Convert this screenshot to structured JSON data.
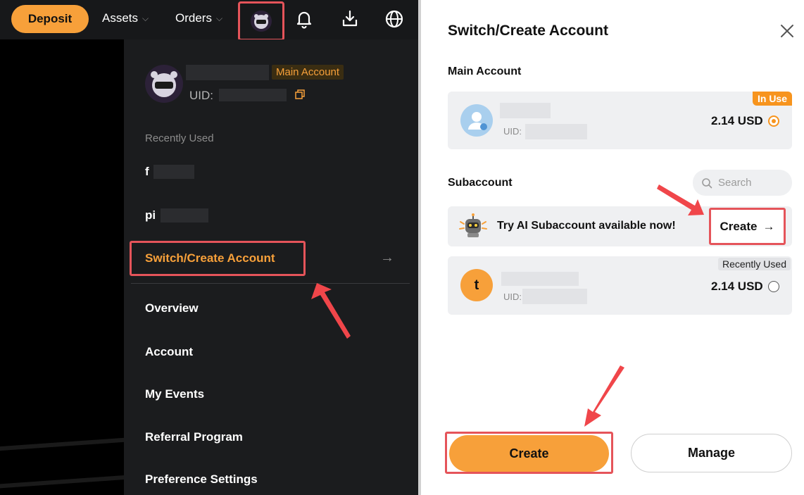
{
  "topbar": {
    "deposit_label": "Deposit",
    "assets_label": "Assets",
    "orders_label": "Orders",
    "icons": [
      "avatar",
      "bell-icon",
      "download-icon",
      "globe-icon"
    ]
  },
  "menu": {
    "badge": "Main Account",
    "uid_label": "UID:",
    "recently_used_label": "Recently Used",
    "recent_items": [
      "f",
      "pi"
    ],
    "switch_label": "Switch/Create Account",
    "items": [
      "Overview",
      "Account",
      "My Events",
      "Referral Program",
      "Preference Settings"
    ]
  },
  "panel": {
    "title": "Switch/Create Account",
    "main_section": "Main Account",
    "main_card": {
      "badge": "In Use",
      "uid_label": "UID:",
      "balance": "2.14 USD"
    },
    "sub_section": "Subaccount",
    "search_placeholder": "Search",
    "ai_promo": {
      "text": "Try AI Subaccount available now!",
      "button": "Create"
    },
    "sub_card": {
      "badge": "Recently Used",
      "initial": "t",
      "uid_label": "UID:",
      "balance": "2.14 USD"
    },
    "create_label": "Create",
    "manage_label": "Manage"
  },
  "colors": {
    "accent": "#f7a03a",
    "highlight": "#e5545a",
    "dark_bg": "#1b1c1e"
  }
}
